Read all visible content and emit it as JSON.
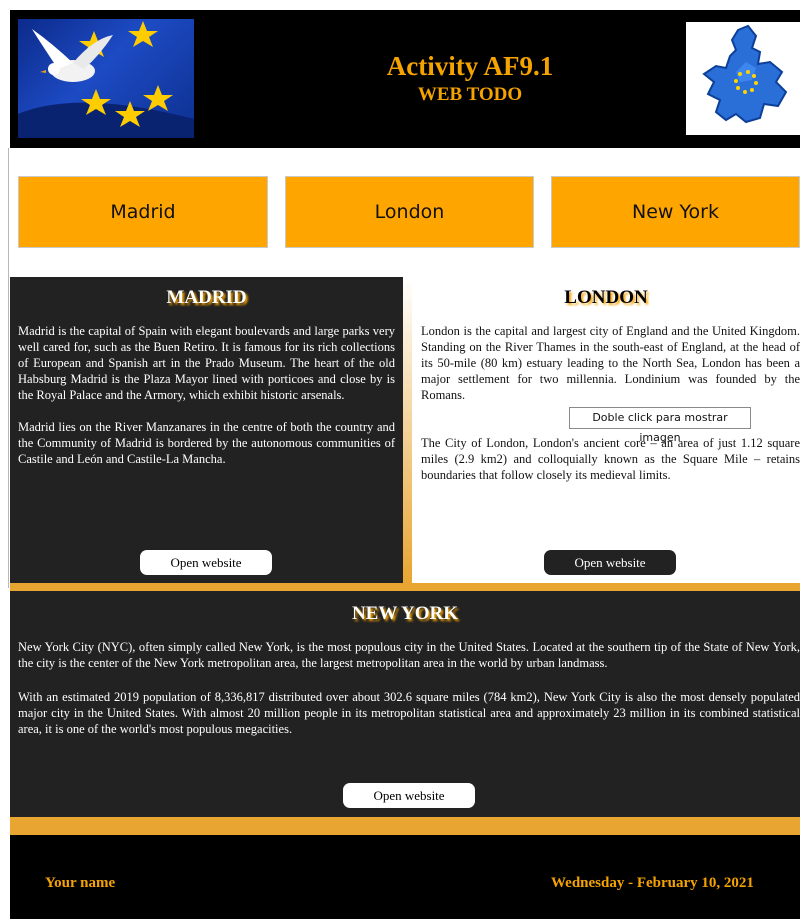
{
  "header": {
    "title": "Activity AF9.1",
    "subtitle": "WEB TODO",
    "logo_left_icon": "eu-flag-dove-icon",
    "logo_right_icon": "eu-map-icon"
  },
  "nav": {
    "items": [
      {
        "label": "Madrid"
      },
      {
        "label": "London"
      },
      {
        "label": "New York"
      }
    ]
  },
  "madrid": {
    "title": "MADRID",
    "paragraphs": [
      "Madrid is the capital of Spain with elegant boulevards and large parks very well cared for, such as the Buen Retiro. It is famous for its rich collections of European and Spanish art in the Prado Museum. The heart of the old Habsburg Madrid is the Plaza Mayor lined with porticoes and close by is the Royal Palace and the Armory, which exhibit historic arsenals.",
      "Madrid lies on the River Manzanares in the centre of both the country and the Community of Madrid is bordered by the autonomous communities of Castile and León and Castile-La Mancha."
    ],
    "button_label": "Open website"
  },
  "london": {
    "title": "LONDON",
    "paragraphs": [
      "London is the capital and largest city of England and the United Kingdom. Standing on the River Thames in the south-east of England, at the head of its 50-mile (80 km) estuary leading to the North Sea, London has been a major settlement for two millennia. Londinium was founded by the Romans.",
      "The City of London, London's ancient core – an area of just 1.12 square miles (2.9 km2) and colloquially known as the Square Mile – retains boundaries that follow closely its medieval limits."
    ],
    "image_button_label": "Doble click para mostrar imagen",
    "button_label": "Open website"
  },
  "newyork": {
    "title": "NEW YORK",
    "paragraphs": [
      "New York City (NYC), often simply called New York, is the most populous city in the United States. Located at the southern tip of the State of New York, the city is the center of the New York metropolitan area, the largest metropolitan area in the world by urban landmass.",
      "With an estimated 2019 population of 8,336,817 distributed over about 302.6 square miles (784 km2), New York City is also the most densely populated major city in the United States. With almost 20 million people in its metropolitan statistical area and approximately 23 million in its combined statistical area, it is one of the world's most populous megacities."
    ],
    "button_label": "Open website"
  },
  "footer": {
    "name": "Your name",
    "date": "Wednesday - February 10, 2021"
  },
  "colors": {
    "accent": "#f5a300",
    "nav_background": "#ffa500",
    "panel_dark": "#222222",
    "gold_band": "#e8a531"
  }
}
